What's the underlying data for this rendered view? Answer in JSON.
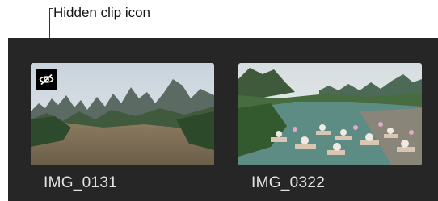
{
  "callout": {
    "label": "Hidden clip icon"
  },
  "clips": [
    {
      "name": "IMG_0131",
      "hidden": true
    },
    {
      "name": "IMG_0322",
      "hidden": false
    }
  ],
  "icons": {
    "hidden_badge": "eye-slash-icon"
  }
}
